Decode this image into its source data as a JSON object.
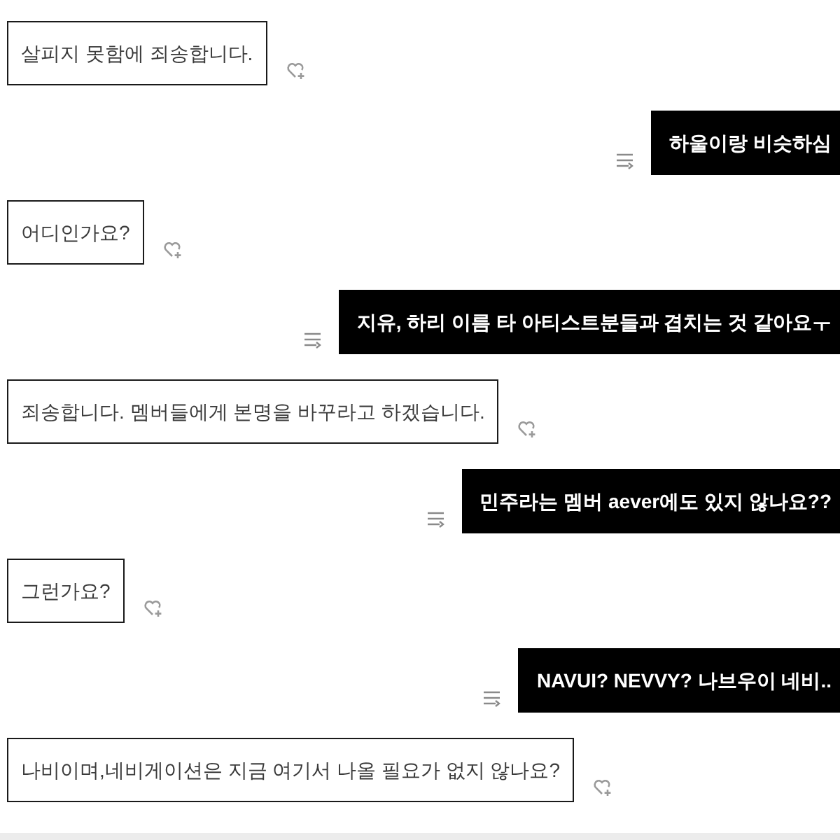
{
  "messages": [
    {
      "kind": "received",
      "text": "살피지 못함에 죄송합니다."
    },
    {
      "kind": "sent",
      "text": "하울이랑 비슷하심"
    },
    {
      "kind": "received",
      "text": "어디인가요?"
    },
    {
      "kind": "sent",
      "text": "지유, 하리 이름 타 아티스트분들과 겹치는 것 같아요ㅜ"
    },
    {
      "kind": "received",
      "text": "죄송합니다. 멤버들에게 본명을 바꾸라고 하겠습니다."
    },
    {
      "kind": "sent",
      "text": "민주라는 멤버 aever에도 있지 않나요??"
    },
    {
      "kind": "received",
      "text": "그런가요?"
    },
    {
      "kind": "sent",
      "text": "NAVUI? NEVVY? 나브우이 네비.."
    },
    {
      "kind": "received",
      "text": "나비이며,네비게이션은 지금 여기서 나올 필요가 없지 않나요?"
    }
  ]
}
